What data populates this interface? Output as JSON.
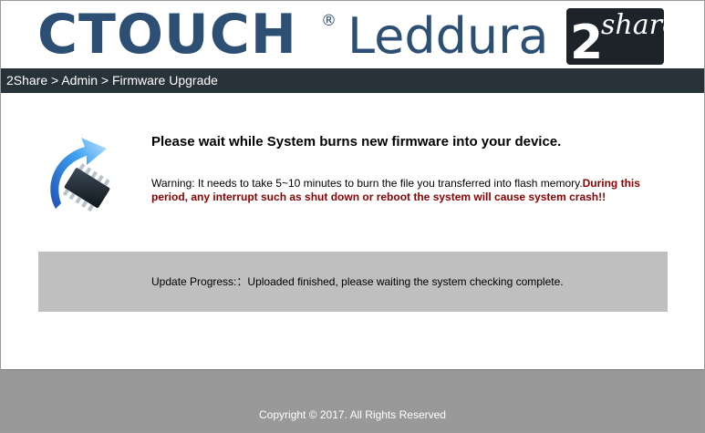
{
  "header": {
    "brand": "CTOUCH",
    "registered_mark": "®",
    "product": "Leddura",
    "badge_number": "2",
    "badge_word": "share"
  },
  "breadcrumb": {
    "items": [
      "2Share",
      "Admin",
      "Firmware Upgrade"
    ],
    "separator": " > "
  },
  "main": {
    "title": "Please wait while System burns new firmware into your device.",
    "warning_text": "Warning: It needs to take 5~10 minutes to burn the file you transferred into flash memory.",
    "warning_emphasis": "During this period, any interrupt such as shut down or reboot the system will cause system crash!!",
    "progress_label": "Update Progress:",
    "progress_colon": "：",
    "progress_status": "Uploaded finished, please waiting the system checking complete."
  },
  "footer": {
    "copyright": "Copyright © 2017. All Rights Reserved"
  },
  "icons": {
    "chip": "chip-upgrade-icon"
  },
  "colors": {
    "brand": "#2d4f74",
    "navbar": "#283239",
    "warning_emphasis": "#8b0000",
    "progress_bg": "#bfbfbf",
    "footer_bg": "#999999"
  }
}
